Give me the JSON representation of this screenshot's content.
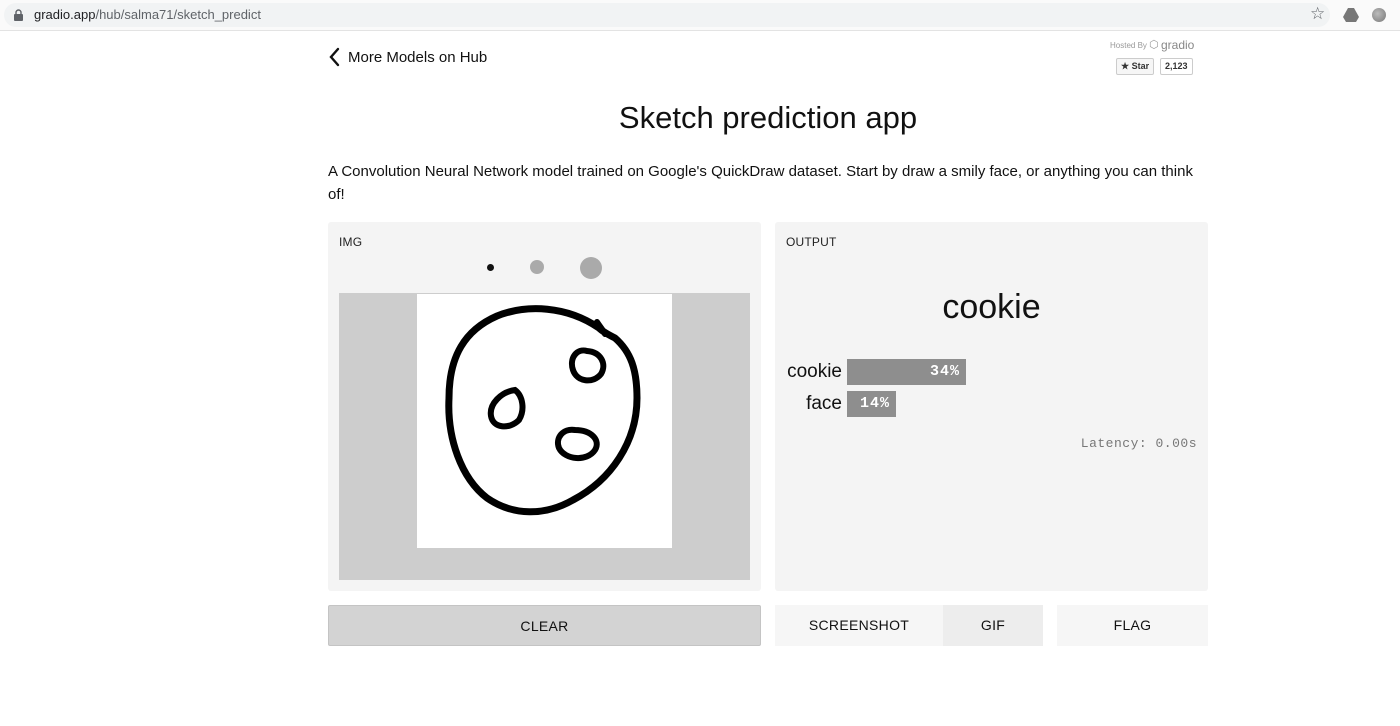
{
  "browser": {
    "url_domain": "gradio.app",
    "url_path": "/hub/salma71/sketch_predict"
  },
  "header": {
    "back_label": "More Models on Hub",
    "hosted_by": "Hosted By",
    "brand": "gradio",
    "star_label": "★ Star",
    "star_count": "2,123"
  },
  "app": {
    "title": "Sketch prediction app",
    "description": "A Convolution Neural Network model trained on Google's QuickDraw dataset. Start by draw a smily face, or anything you can think of!"
  },
  "input_panel": {
    "label": "IMG",
    "brush_sizes": [
      "small",
      "medium",
      "large"
    ]
  },
  "output_panel": {
    "label": "OUTPUT",
    "prediction": "cookie",
    "confidences": [
      {
        "label": "cookie",
        "value": 0.34,
        "text": "34%"
      },
      {
        "label": "face",
        "value": 0.14,
        "text": "14%"
      }
    ],
    "latency": "Latency: 0.00s"
  },
  "buttons": {
    "clear": "CLEAR",
    "screenshot": "SCREENSHOT",
    "gif": "GIF",
    "flag": "FLAG"
  },
  "colors": {
    "bar": "#8e8e8e",
    "panel_bg": "#f4f4f4",
    "canvas_bg": "#cdcdcd"
  }
}
